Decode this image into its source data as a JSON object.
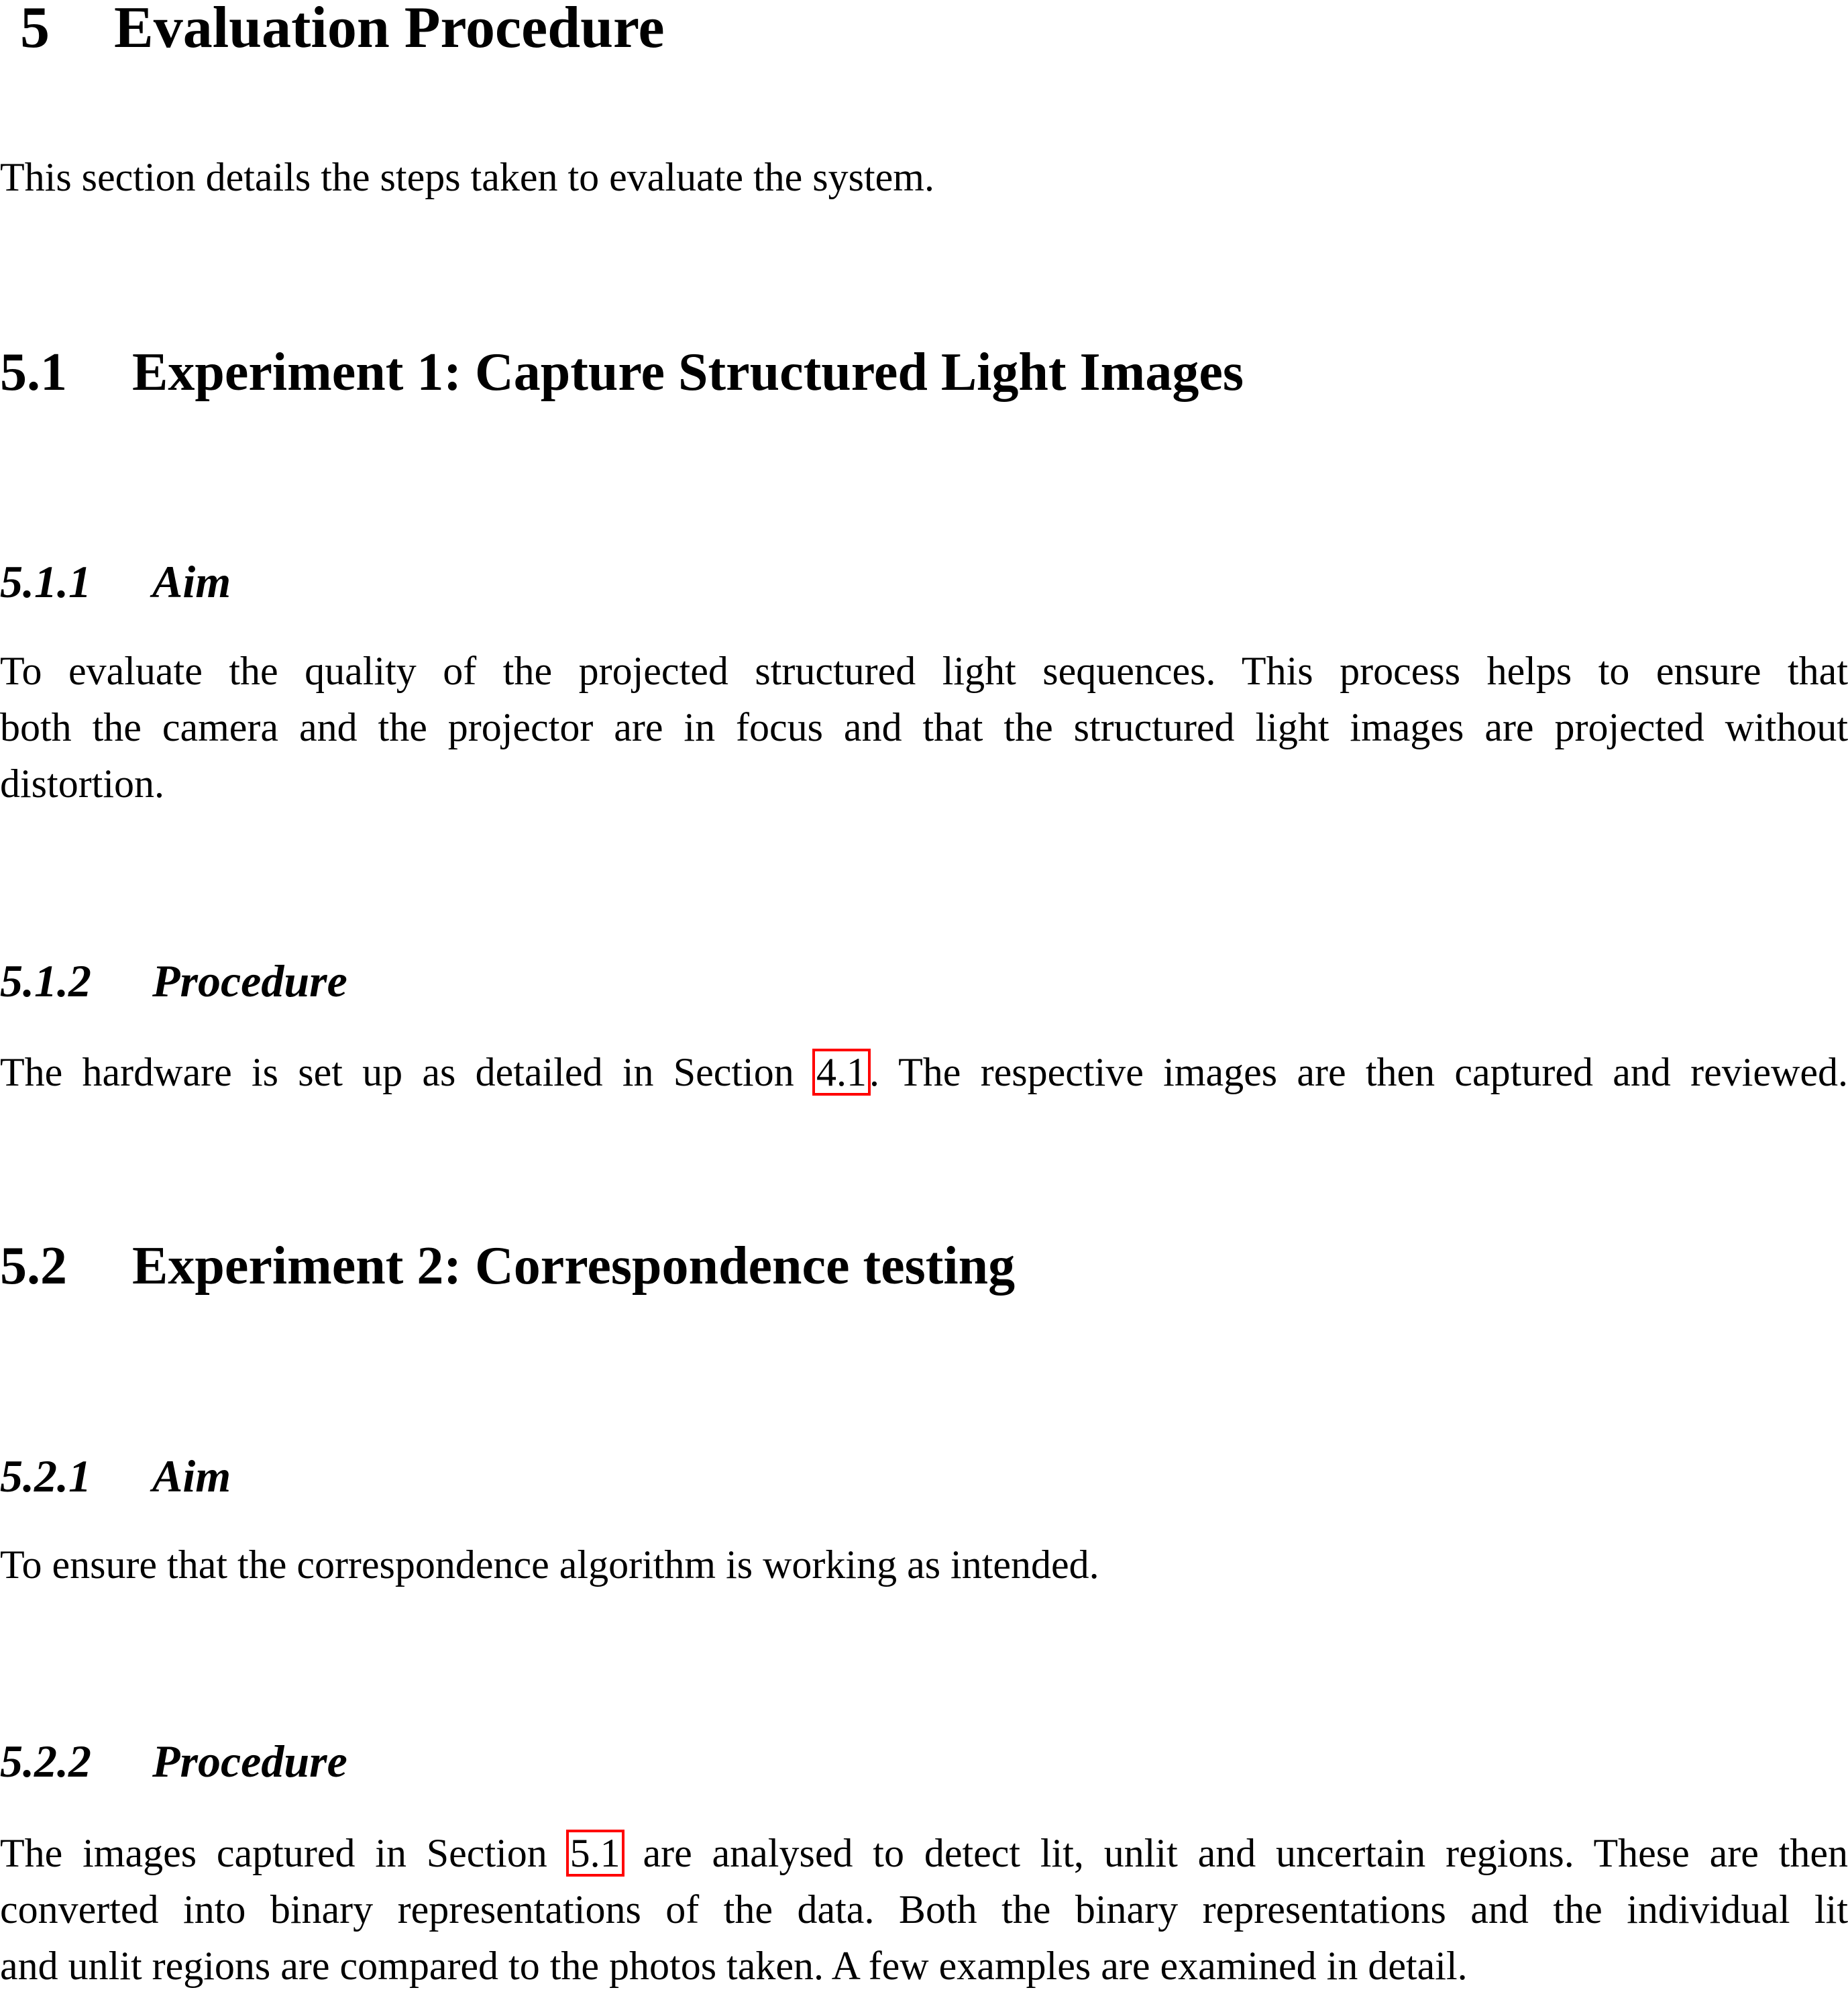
{
  "section": {
    "number": "5",
    "title": "Evaluation Procedure",
    "intro": "This section details the steps taken to evaluate the system."
  },
  "subsections": [
    {
      "number": "5.1",
      "title": "Experiment 1: Capture Structured Light Images",
      "aim": {
        "number": "5.1.1",
        "title": "Aim",
        "lines": [
          "To evaluate the quality of the projected structured light sequences. This process helps to ensure that",
          "both the camera and the projector are in focus and that the structured light images are projected without",
          "distortion."
        ]
      },
      "procedure": {
        "number": "5.1.2",
        "title": "Procedure",
        "before_ref": "The hardware is set up as detailed in Section ",
        "ref": "4.1",
        "after_ref": ". The respective images are then captured and reviewed."
      }
    },
    {
      "number": "5.2",
      "title": "Experiment 2: Correspondence testing",
      "aim": {
        "number": "5.2.1",
        "title": "Aim",
        "lines": [
          "To ensure that the correspondence algorithm is working as intended."
        ]
      },
      "procedure": {
        "number": "5.2.2",
        "title": "Procedure",
        "before_ref": "The images captured in Section ",
        "ref": "5.1",
        "after_ref": " are analysed to detect lit, unlit and uncertain regions. These are then",
        "lines": [
          "converted into binary representations of the data. Both the binary representations and the individual lit",
          "and unlit regions are compared to the photos taken. A few examples are examined in detail."
        ]
      }
    }
  ],
  "colors": {
    "text": "#000000",
    "link_box": "#ff0000",
    "background": "#ffffff"
  }
}
